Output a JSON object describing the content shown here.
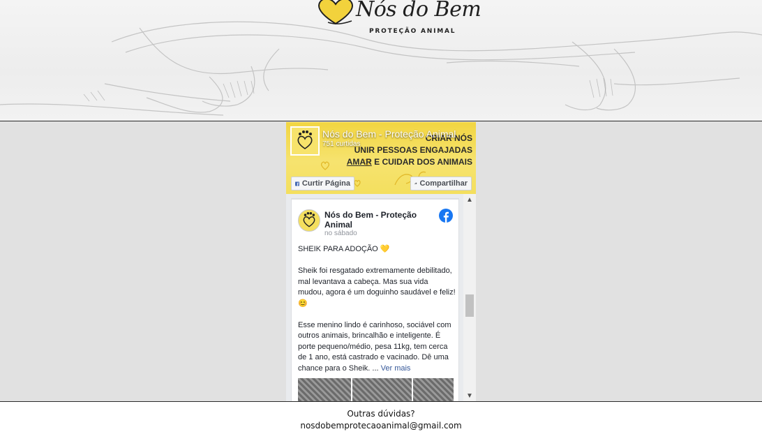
{
  "logo": {
    "script_text": "Nós do Bem",
    "subtitle": "PROTEÇÃO ANIMAL"
  },
  "fb_plugin": {
    "page_name": "Nós do Bem - Proteção Animal",
    "likes": "751 curtidas",
    "cover_tagline": {
      "line1": "CRIAR NÓS",
      "line2": "UNIR PESSOAS ENGAJADAS",
      "line3_underlined": "AMAR",
      "line3_rest": " E CUIDAR DOS ANIMAIS"
    },
    "like_button": "Curtir Página",
    "share_button": "Compartilhar",
    "post": {
      "author": "Nós do Bem - Proteção Animal",
      "time": "no sábado",
      "headline": "SHEIK PARA ADOÇÃO 💛",
      "paragraph1": "Sheik foi resgatado extremamente debilitado, mal levantava a cabeça. Mas sua vida mudou, agora é um doguinho saudável e feliz! 😊",
      "paragraph2": "Esse menino lindo é carinhoso, sociável com outros animais, brincalhão e inteligente. É porte pequeno/médio, pesa 11kg, tem cerca de 1 ano, está castrado e vacinado. Dê uma chance para o Sheik. ...",
      "see_more": "Ver mais"
    },
    "colors": {
      "cover_yellow": "#f4df5e",
      "facebook_blue": "#1877f2",
      "link_blue": "#365899"
    }
  },
  "footer": {
    "question": "Outras dúvidas?",
    "email": "nosdobemprotecaoanimal@gmail.com"
  }
}
